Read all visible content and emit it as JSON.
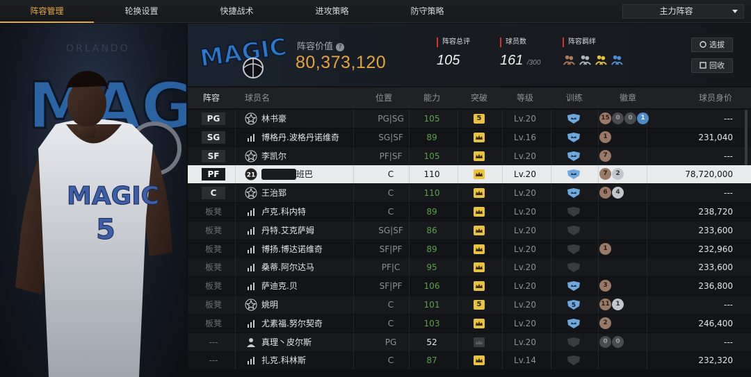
{
  "nav": {
    "tabs": [
      {
        "label": "阵容管理",
        "active": true
      },
      {
        "label": "轮换设置",
        "active": false
      },
      {
        "label": "快捷战术",
        "active": false
      },
      {
        "label": "进攻策略",
        "active": false
      },
      {
        "label": "防守策略",
        "active": false
      }
    ],
    "lineup_select": "主力阵容"
  },
  "hero": {
    "jersey_number": "5",
    "team_word": "MAGIC",
    "city_word": "ORLANDO"
  },
  "header": {
    "team_logo_text": "MAGIC",
    "lineup_value_label": "阵容价值",
    "lineup_value": "80,373,120",
    "total_rating_label": "阵容总评",
    "total_rating": "105",
    "player_count_label": "球员数",
    "player_count": "161",
    "player_count_max": "/300",
    "bond_label": "阵容羁绊",
    "bond_icons": [
      "bond-bronze-icon",
      "bond-silver-icon",
      "bond-gold-icon",
      "bond-blue-icon"
    ],
    "select_button": "选拔",
    "recycle_button": "回收"
  },
  "columns": [
    "阵容",
    "球员名",
    "位置",
    "能力",
    "突破",
    "等级",
    "训练",
    "徽章",
    "球员身价"
  ],
  "rows": [
    {
      "slot": "PG",
      "icon": "star",
      "name": "林书豪",
      "pos": "PG|SG",
      "ability": "105",
      "break": "5",
      "level": "Lv.20",
      "train": "on",
      "badges": [
        [
          "15",
          "br"
        ],
        [
          "0",
          "dk"
        ],
        [
          "0",
          "dk"
        ],
        [
          "1",
          "bl"
        ]
      ],
      "value": "---"
    },
    {
      "slot": "SG",
      "icon": "bars",
      "name": "博格丹.波格丹诺维奇",
      "pos": "SG|SF",
      "ability": "89",
      "break": "crown",
      "level": "Lv.16",
      "train": "on",
      "badges": [
        [
          "1",
          "br"
        ]
      ],
      "value": "231,040"
    },
    {
      "slot": "SF",
      "icon": "star",
      "name": "李凯尔",
      "pos": "PF|SF",
      "ability": "105",
      "break": "crown",
      "level": "Lv.20",
      "train": "on",
      "badges": [
        [
          "7",
          "br"
        ]
      ],
      "value": "---"
    },
    {
      "slot": "PF",
      "icon": "num21",
      "name": ".班巴",
      "pos": "C",
      "ability": "110",
      "break": "crown",
      "level": "Lv.20",
      "train": "on",
      "badges": [
        [
          "7",
          "br"
        ],
        [
          "2",
          "sv"
        ]
      ],
      "value": "78,720,000",
      "selected": true
    },
    {
      "slot": "C",
      "icon": "star",
      "name": "王治郅",
      "pos": "C",
      "ability": "110",
      "break": "crown",
      "level": "Lv.20",
      "train": "on",
      "badges": [
        [
          "6",
          "br"
        ],
        [
          "4",
          "sv"
        ]
      ],
      "value": "---"
    },
    {
      "slot": "板凳",
      "icon": "bars",
      "name": "卢克.科内特",
      "pos": "C",
      "ability": "89",
      "break": "crown",
      "level": "Lv.20",
      "train": "off",
      "badges": [],
      "value": "238,720"
    },
    {
      "slot": "板凳",
      "icon": "bars",
      "name": "丹特.艾克萨姆",
      "pos": "SG|SF",
      "ability": "86",
      "break": "crown",
      "level": "Lv.20",
      "train": "off",
      "badges": [],
      "value": "233,600"
    },
    {
      "slot": "板凳",
      "icon": "bars",
      "name": "博扬.博达诺维奇",
      "pos": "SF|PF",
      "ability": "89",
      "break": "crown",
      "level": "Lv.20",
      "train": "off",
      "badges": [
        [
          "1",
          "br"
        ]
      ],
      "value": "232,960"
    },
    {
      "slot": "板凳",
      "icon": "bars",
      "name": "桑蒂.阿尔达马",
      "pos": "PF|C",
      "ability": "95",
      "break": "crown",
      "level": "Lv.20",
      "train": "off",
      "badges": [],
      "value": "233,600"
    },
    {
      "slot": "板凳",
      "icon": "bars",
      "name": "萨迪克.贝",
      "pos": "SF|PF",
      "ability": "106",
      "break": "crown",
      "level": "Lv.20",
      "train": "on",
      "badges": [
        [
          "3",
          "br"
        ]
      ],
      "value": "236,800"
    },
    {
      "slot": "板凳",
      "icon": "star",
      "name": "姚明",
      "pos": "C",
      "ability": "101",
      "break": "5",
      "level": "Lv.20",
      "train": "on5",
      "badges": [
        [
          "11",
          "br"
        ],
        [
          "1",
          "sv"
        ]
      ],
      "value": "---"
    },
    {
      "slot": "板凳",
      "icon": "bars",
      "name": "尤素福.努尔契奇",
      "pos": "C",
      "ability": "103",
      "break": "crown",
      "level": "Lv.20",
      "train": "on",
      "badges": [
        [
          "2",
          "br"
        ]
      ],
      "value": "246,400"
    },
    {
      "slot": "---",
      "icon": "person",
      "name": "真理丶皮尔斯",
      "pos": "PG",
      "ability": "52",
      "break": "dim",
      "level": "Lv.20",
      "train": "off",
      "badges": [
        [
          "0",
          "dk"
        ],
        [
          "0",
          "dk"
        ]
      ],
      "value": "---"
    },
    {
      "slot": "---",
      "icon": "bars",
      "name": "扎克.科林斯",
      "pos": "C",
      "ability": "87",
      "break": "crown",
      "level": "Lv.14",
      "train": "off",
      "badges": [],
      "value": "232,320"
    }
  ]
}
